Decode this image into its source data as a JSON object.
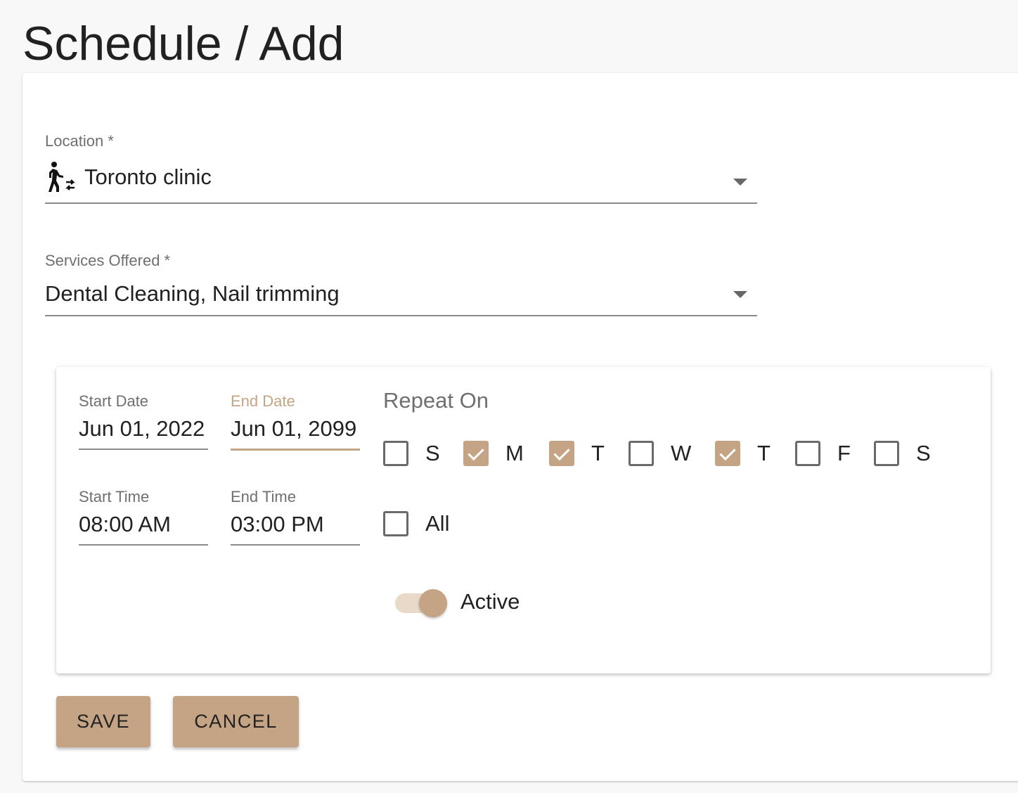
{
  "page": {
    "title": "Schedule / Add"
  },
  "form": {
    "location": {
      "label": "Location *",
      "value": "Toronto clinic",
      "icon": "person-walking-transfer-icon"
    },
    "services": {
      "label": "Services Offered *",
      "value": "Dental Cleaning, Nail trimming"
    },
    "schedule": {
      "start_date": {
        "label": "Start Date",
        "value": "Jun 01, 2022"
      },
      "end_date": {
        "label": "End Date",
        "value": "Jun 01, 2099"
      },
      "start_time": {
        "label": "Start Time",
        "value": "08:00 AM"
      },
      "end_time": {
        "label": "End Time",
        "value": "03:00 PM"
      },
      "repeat_on": {
        "title": "Repeat On",
        "days": [
          {
            "letter": "S",
            "checked": false
          },
          {
            "letter": "M",
            "checked": true
          },
          {
            "letter": "T",
            "checked": true
          },
          {
            "letter": "W",
            "checked": false
          },
          {
            "letter": "T",
            "checked": true
          },
          {
            "letter": "F",
            "checked": false
          },
          {
            "letter": "S",
            "checked": false
          }
        ],
        "all": {
          "label": "All",
          "checked": false
        }
      },
      "active": {
        "label": "Active",
        "on": true
      }
    }
  },
  "actions": {
    "save_label": "SAVE",
    "cancel_label": "CANCEL"
  },
  "theme": {
    "accent": "#c4a484",
    "accent_light": "#e8d9c9",
    "background": "#f8f8f8"
  }
}
